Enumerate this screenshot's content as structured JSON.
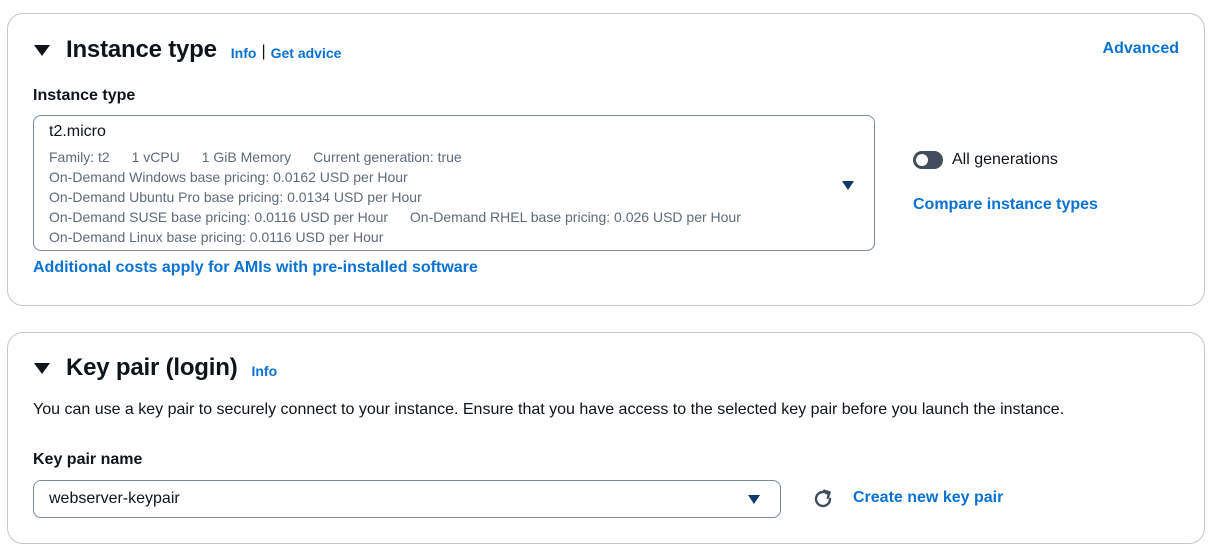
{
  "instance_type": {
    "title": "Instance type",
    "info": "Info",
    "separator": "|",
    "get_advice": "Get advice",
    "advanced": "Advanced",
    "field_label": "Instance type",
    "selected": {
      "name": "t2.micro",
      "details": [
        "Family: t2",
        "1 vCPU",
        "1 GiB Memory",
        "Current generation: true"
      ],
      "pricing": {
        "windows": "On-Demand Windows base pricing: 0.0162 USD per Hour",
        "ubuntu_pro": "On-Demand Ubuntu Pro base pricing: 0.0134 USD per Hour",
        "suse": "On-Demand SUSE base pricing: 0.0116 USD per Hour",
        "rhel": "On-Demand RHEL base pricing: 0.026 USD per Hour",
        "linux": "On-Demand Linux base pricing: 0.0116 USD per Hour"
      }
    },
    "all_generations_label": "All generations",
    "all_generations_on": false,
    "compare_link": "Compare instance types",
    "additional_costs_link": "Additional costs apply for AMIs with pre-installed software"
  },
  "key_pair": {
    "title": "Key pair (login)",
    "info": "Info",
    "description": "You can use a key pair to securely connect to your instance. Ensure that you have access to the selected key pair before you launch the instance.",
    "field_label": "Key pair name",
    "selected": "webserver-keypair",
    "create_link": "Create new key pair"
  },
  "colors": {
    "link": "#0972d3",
    "text": "#0f141a",
    "secondary_text": "#5f6b7a",
    "border": "#c6c6cd"
  }
}
